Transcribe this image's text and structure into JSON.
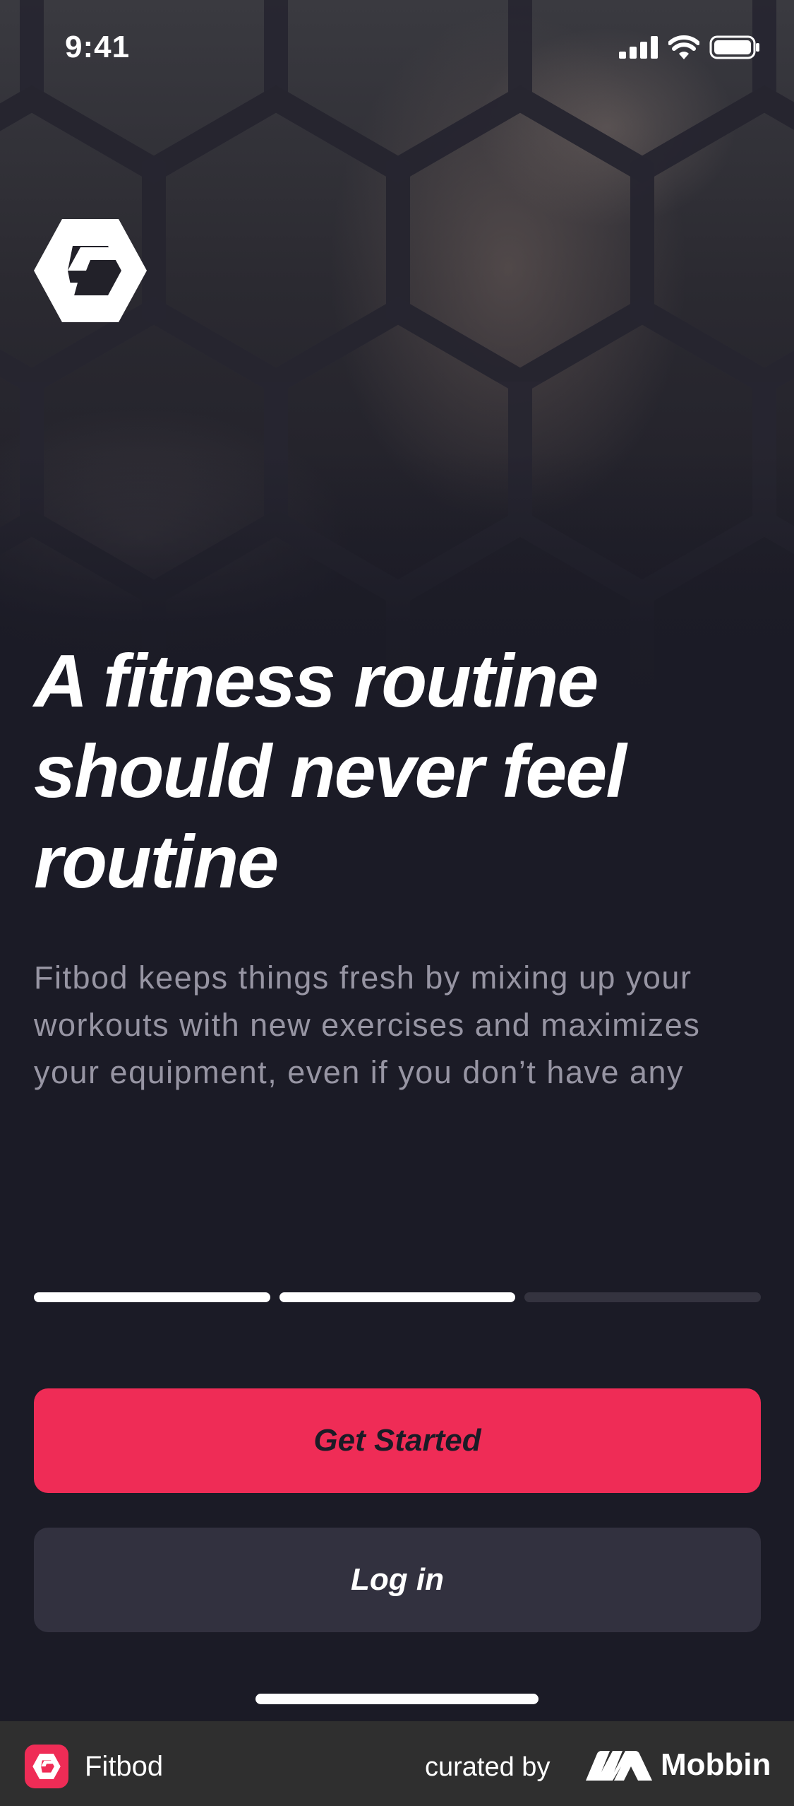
{
  "status_bar": {
    "time": "9:41"
  },
  "hero": {
    "headline": "A fitness routine should never feel routine",
    "description": "Fitbod keeps things fresh by mixing up your workouts with new exercises and maximizes your equipment, even if you don’t have any"
  },
  "progress": {
    "steps_total": 3,
    "steps_completed": 2
  },
  "buttons": {
    "primary_label": "Get Started",
    "secondary_label": "Log in"
  },
  "footer": {
    "app_name": "Fitbod",
    "curated_label": "curated by",
    "brand_name": "Mobbin"
  },
  "colors": {
    "accent": "#ef2c56",
    "background": "#1b1b26",
    "secondary_button": "#32313f",
    "footer": "#2f2f2f"
  }
}
